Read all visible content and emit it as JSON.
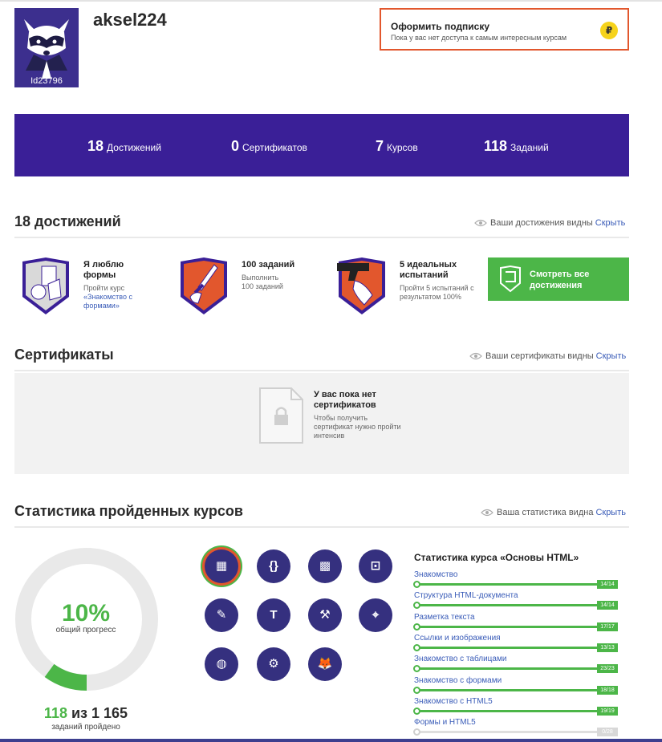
{
  "profile": {
    "username": "aksel224",
    "user_id": "Id23796"
  },
  "subscription": {
    "title": "Оформить подписку",
    "text": "Пока у вас нет доступа к самым интересным курсам",
    "icon": "₽"
  },
  "stats": [
    {
      "value": "18",
      "label": "Достижений"
    },
    {
      "value": "0",
      "label": "Сертификатов"
    },
    {
      "value": "7",
      "label": "Курсов"
    },
    {
      "value": "118",
      "label": "Заданий"
    }
  ],
  "achievements": {
    "title": "18 достижений",
    "visibility_text": "Ваши достижения видны",
    "hide_label": "Скрыть",
    "items": [
      {
        "title": "Я люблю формы",
        "desc": "Пройти курс",
        "link": "«Знакомство с формами»",
        "icon": "shapes-badge-icon"
      },
      {
        "title": "100 заданий",
        "desc": "Выполнить 100 заданий",
        "icon": "sword-badge-icon"
      },
      {
        "title": "5 идеальных испытаний",
        "desc": "Пройти 5 испытаний с результатом 100%",
        "icon": "pistol-badge-icon"
      }
    ],
    "view_all_label": "Смотреть все достижения"
  },
  "certificates": {
    "title": "Сертификаты",
    "visibility_text": "Ваши сертификаты видны",
    "hide_label": "Скрыть",
    "empty_title": "У вас пока нет сертификатов",
    "empty_desc": "Чтобы получить сертификат нужно пройти интенсив"
  },
  "course_stats": {
    "title": "Статистика пройденных курсов",
    "visibility_text": "Ваша статистика видна",
    "hide_label": "Скрыть",
    "progress_percent": "10%",
    "progress_value": 0.1,
    "progress_caption": "общий прогресс",
    "tasks_done": "118",
    "tasks_of": "из",
    "tasks_total": "1 165",
    "tasks_caption": "заданий пройдено",
    "course_icons": [
      "html-basics-icon",
      "braces-icon",
      "cube-icon",
      "field-icon",
      "paintbrush-icon",
      "typography-icon",
      "anvil-icon",
      "vector-icon",
      "sphere-icon",
      "chainsaw-icon",
      "fox-icon"
    ],
    "selected_course_title": "Статистика курса «Основы HTML»",
    "modules": [
      {
        "name": "Знакомство",
        "done": 14,
        "total": 14,
        "badge": "14/14"
      },
      {
        "name": "Структура HTML-документа",
        "done": 14,
        "total": 14,
        "badge": "14/14"
      },
      {
        "name": "Разметка текста",
        "done": 17,
        "total": 17,
        "badge": "17/17"
      },
      {
        "name": "Ссылки и изображения",
        "done": 13,
        "total": 13,
        "badge": "13/13"
      },
      {
        "name": "Знакомство с таблицами",
        "done": 23,
        "total": 23,
        "badge": "23/23"
      },
      {
        "name": "Знакомство с формами",
        "done": 18,
        "total": 18,
        "badge": "18/18"
      },
      {
        "name": "Знакомство с HTML5",
        "done": 19,
        "total": 19,
        "badge": "19/19"
      },
      {
        "name": "Формы и HTML5",
        "done": 0,
        "total": 28,
        "badge": "0/28"
      }
    ]
  },
  "colors": {
    "brand_purple": "#3a1f97",
    "accent_green": "#4cb648",
    "accent_orange": "#e2572d",
    "link_blue": "#3a5cb8"
  }
}
